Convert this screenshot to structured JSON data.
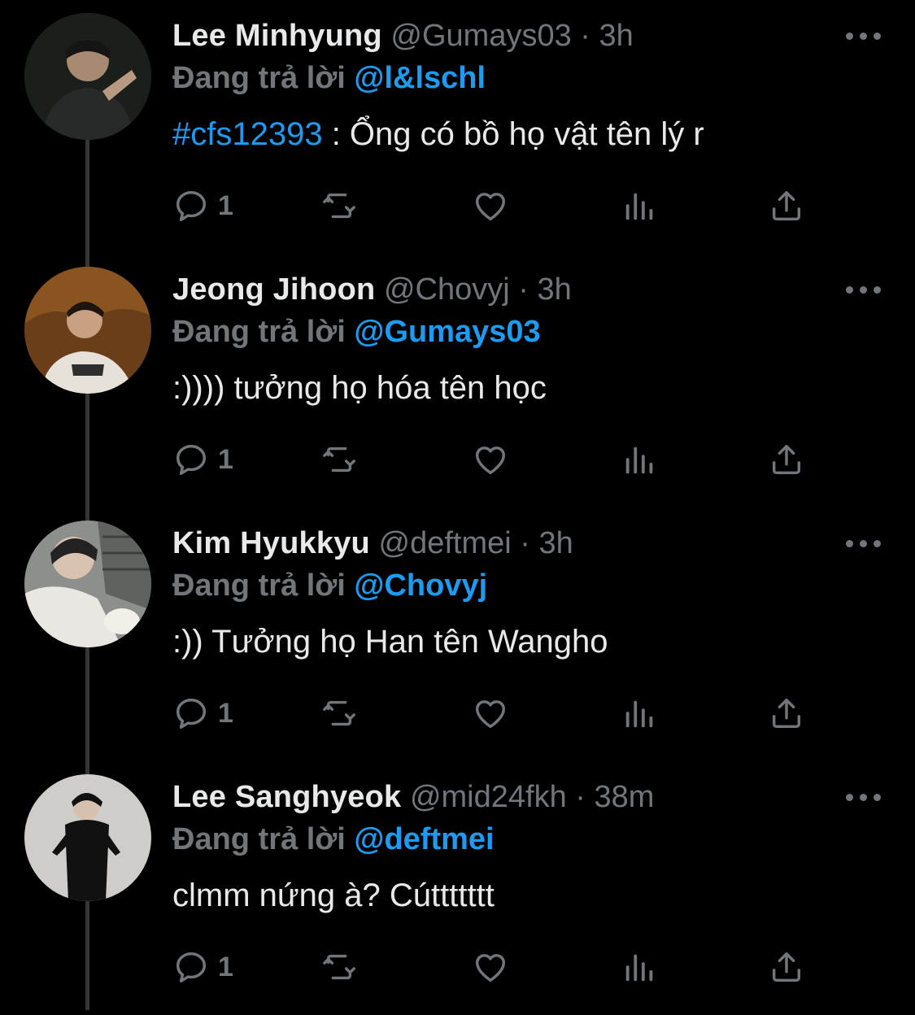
{
  "colors": {
    "background": "#000000",
    "link": "#1d9bf0",
    "muted": "#71767b",
    "text": "#e7e9ea"
  },
  "icons": {
    "reply": "reply-icon",
    "retweet": "retweet-icon",
    "like": "heart-icon",
    "views": "views-icon",
    "share": "share-icon",
    "more": "more-icon"
  },
  "tweets": [
    {
      "name": "Lee Minhyung",
      "handle": "@Gumays03",
      "sep": "·",
      "time": "3h",
      "reply_label": "Đang trả lời",
      "reply_to": "@l&lschl",
      "hashtag": "#cfs12393",
      "text": " : Ổng có bồ họ vật tên lý r",
      "reply_count": "1"
    },
    {
      "name": "Jeong Jihoon",
      "handle": "@Chovyj",
      "sep": "·",
      "time": "3h",
      "reply_label": "Đang trả lời",
      "reply_to": "@Gumays03",
      "hashtag": "",
      "text": ":)))) tưởng họ hóa tên học",
      "reply_count": "1"
    },
    {
      "name": "Kim Hyukkyu",
      "handle": "@deftmei",
      "sep": "·",
      "time": "3h",
      "reply_label": "Đang trả lời",
      "reply_to": "@Chovyj",
      "hashtag": "",
      "text": ":)) Tưởng họ Han tên Wangho",
      "reply_count": "1"
    },
    {
      "name": "Lee Sanghyeok",
      "handle": "@mid24fkh",
      "sep": "·",
      "time": "38m",
      "reply_label": "Đang trả lời",
      "reply_to": "@deftmei",
      "hashtag": "",
      "text": "clmm nứng à? Cúttttttt",
      "reply_count": "1"
    }
  ]
}
